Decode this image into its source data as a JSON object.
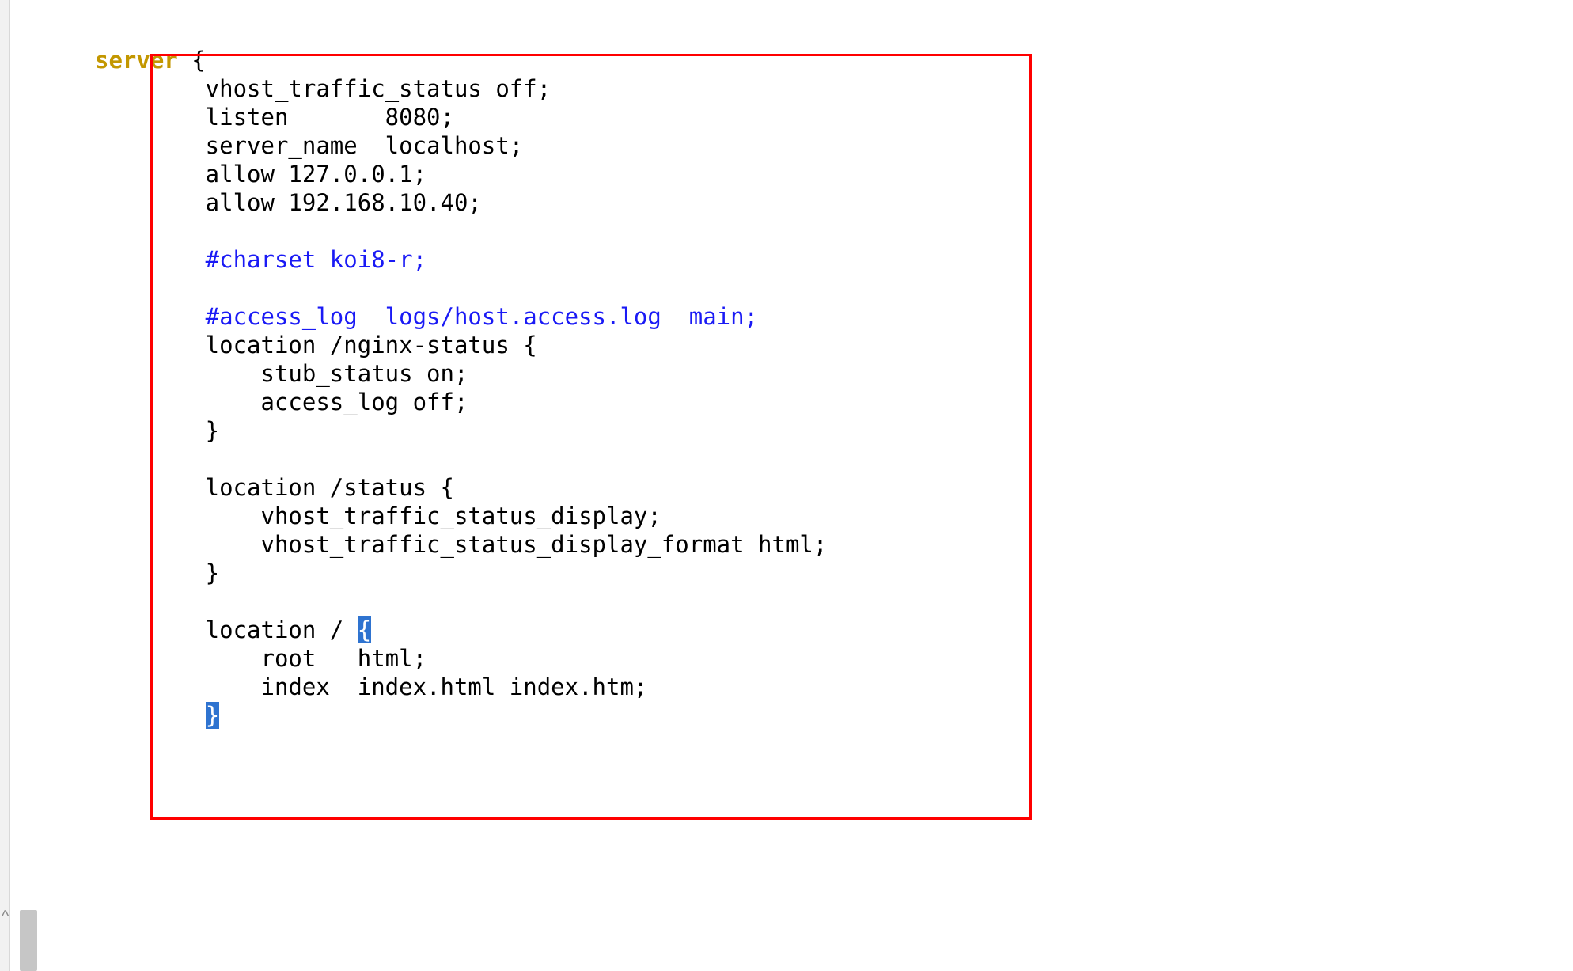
{
  "code": {
    "l0_server": "server",
    "l0_brace": " {",
    "l1": "        vhost_traffic_status off;",
    "l2": "        listen       8080;",
    "l3": "        server_name  localhost;",
    "l4": "        allow 127.0.0.1;",
    "l5": "        allow 192.168.10.40;",
    "blank": "",
    "l6_comment": "        #charset koi8-r;",
    "l7_comment": "        #access_log  logs/host.access.log  main;",
    "l8": "        location /nginx-status {",
    "l9": "            stub_status on;",
    "l10": "            access_log off;",
    "l11": "        }",
    "l12": "        location /status {",
    "l13": "            vhost_traffic_status_display;",
    "l14": "            vhost_traffic_status_display_format html;",
    "l15": "        }",
    "l16_pre": "        location / ",
    "l16_hl": "{",
    "l17": "            root   html;",
    "l18": "            index  index.html index.htm;",
    "l19_pre": "        ",
    "l19_hl": "}",
    "gutter_mark": "^"
  }
}
